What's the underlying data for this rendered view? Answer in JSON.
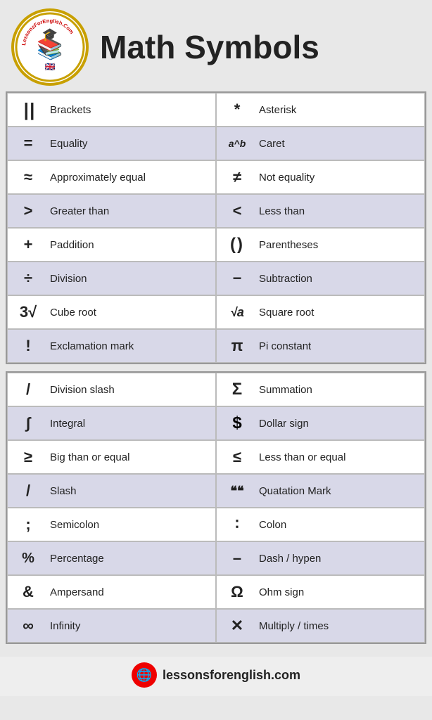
{
  "header": {
    "title": "Math Symbols",
    "logo_alt": "LessonsForEnglish.Com"
  },
  "footer": {
    "url": "lessonsforenglish.com"
  },
  "table1": {
    "rows": [
      {
        "symbol": "| |",
        "label": "Brackets",
        "symbol2": "*",
        "label2": "Asterisk"
      },
      {
        "symbol": "=",
        "label": "Equality",
        "symbol2": "a^b",
        "label2": "Caret"
      },
      {
        "symbol": "≈",
        "label": "Approximately equal",
        "symbol2": "≠",
        "label2": "Not equality"
      },
      {
        "symbol": ">",
        "label": "Greater than",
        "symbol2": "<",
        "label2": "Less than"
      },
      {
        "symbol": "+",
        "label": "Paddition",
        "symbol2": "()",
        "label2": "Parentheses"
      },
      {
        "symbol": "÷",
        "label": "Division",
        "symbol2": "−",
        "label2": "Subtraction"
      },
      {
        "symbol": "3√",
        "label": "Cube root",
        "symbol2": "√a",
        "label2": "Square root"
      },
      {
        "symbol": "!",
        "label": "Exclamation mark",
        "symbol2": "π",
        "label2": "Pi constant"
      }
    ]
  },
  "table2": {
    "rows": [
      {
        "symbol": "/",
        "label": "Division slash",
        "symbol2": "Σ",
        "label2": "Summation"
      },
      {
        "symbol": "∫",
        "label": "Integral",
        "symbol2": "$",
        "label2": "Dollar sign"
      },
      {
        "symbol": "≥",
        "label": "Big than or equal",
        "symbol2": "≤",
        "label2": "Less than or equal"
      },
      {
        "symbol": "/",
        "label": "Slash",
        "symbol2": "❝❝",
        "label2": "Quatation Mark"
      },
      {
        "symbol": ";",
        "label": "Semicolon",
        "symbol2": "∶",
        "label2": "Colon"
      },
      {
        "symbol": "%",
        "label": "Percentage",
        "symbol2": "–",
        "label2": "Dash / hypen"
      },
      {
        "symbol": "&",
        "label": "Ampersand",
        "symbol2": "Ω",
        "label2": "Ohm sign"
      },
      {
        "symbol": "∞",
        "label": "Infinity",
        "symbol2": "✕",
        "label2": "Multiply / times"
      }
    ]
  }
}
